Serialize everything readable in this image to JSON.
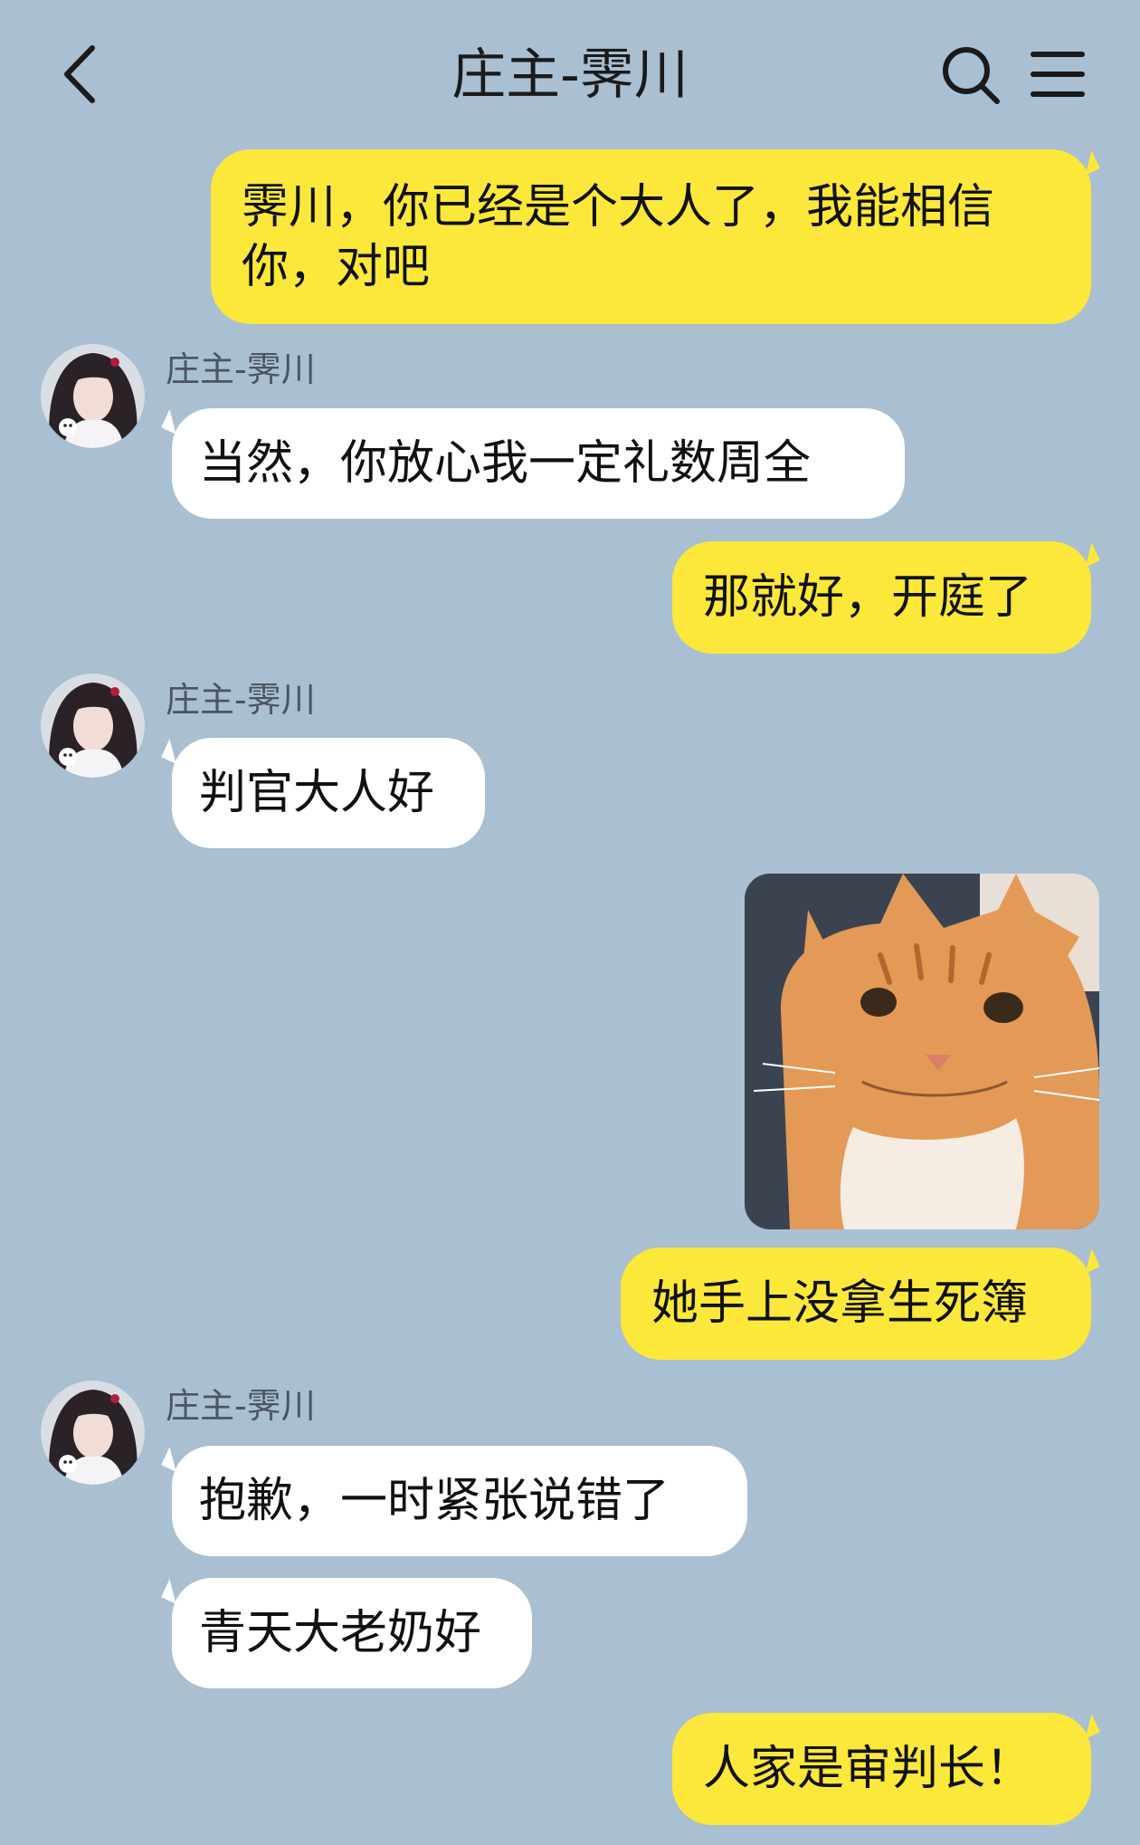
{
  "header": {
    "title": "庄主-霁川"
  },
  "icons": {
    "back": "back-chevron-icon",
    "search": "search-icon",
    "menu": "menu-icon"
  },
  "colors": {
    "background": "#a9bfd2",
    "my_bubble": "#fbe83a",
    "their_bubble": "#ffffff"
  },
  "messages": [
    {
      "from": "me",
      "text": "霁川，你已经是个大人了，我能相信你，对吧"
    },
    {
      "from": "other",
      "sender": "庄主-霁川",
      "text": "当然，你放心我一定礼数周全"
    },
    {
      "from": "me",
      "text": "那就好，开庭了"
    },
    {
      "from": "other",
      "sender": "庄主-霁川",
      "text": "判官大人好"
    },
    {
      "from": "me",
      "image": "orange-cat-sticker"
    },
    {
      "from": "me",
      "text": "她手上没拿生死簿"
    },
    {
      "from": "other",
      "sender": "庄主-霁川",
      "text": "抱歉，一时紧张说错了"
    },
    {
      "from": "other",
      "text": "青天大老奶好"
    },
    {
      "from": "me",
      "text": "人家是审判长！"
    }
  ]
}
